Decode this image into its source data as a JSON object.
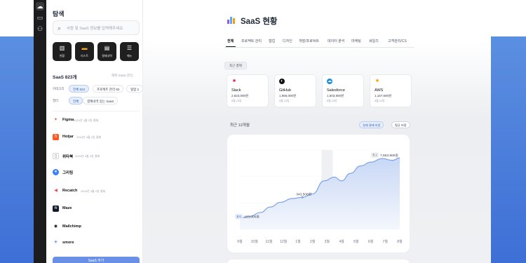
{
  "sidebar": {
    "title": "탐색",
    "search_placeholder": "사람 및 SaaS 정보를 입력해주세요",
    "quick_actions": [
      {
        "label": "현황",
        "icon": "chart-icon"
      },
      {
        "label": "리스트",
        "icon": "folder-icon"
      },
      {
        "label": "결제내역",
        "icon": "receipt-icon"
      },
      {
        "label": "메뉴",
        "icon": "menu-icon"
      }
    ],
    "count_label": "SaaS 823개",
    "count_right": "해외 SaaS 관리",
    "filters": {
      "category_label": "카테고리",
      "category_chips": [
        "전체 823",
        "프로젝트 관리 82",
        "협업 2"
      ],
      "status_label": "필터",
      "status_chips": [
        "전체",
        "결제내역 있는 SaaS"
      ]
    },
    "apps": [
      {
        "name": "Figma",
        "date": "2024년 4월 2일 결제",
        "icon_color": "#f24e1e",
        "glyph": "F"
      },
      {
        "name": "Hotjar",
        "date": "2024년 4월 2일 결제",
        "icon_color": "#ff3c00",
        "glyph": "h"
      },
      {
        "name": "위타북",
        "date": "2024년 4월 2일 결제",
        "icon_color": "#ffffff",
        "glyph": "📄"
      },
      {
        "name": "그리팅",
        "date": "",
        "icon_color": "#3b82f6",
        "glyph": "●"
      },
      {
        "name": "Recatch",
        "date": "2024년 4월 2일 결제",
        "icon_color": "#ef4444",
        "glyph": "▶"
      },
      {
        "name": "Maze",
        "date": "",
        "icon_color": "#111827",
        "glyph": "≋"
      },
      {
        "name": "Mailchimp",
        "date": "",
        "icon_color": "#111111",
        "glyph": "◉"
      },
      {
        "name": "smore",
        "date": "",
        "icon_color": "#3b5bdb",
        "glyph": "✳"
      }
    ],
    "cta_label": "SaaS 추가"
  },
  "main": {
    "title": "SaaS 현황",
    "tabs": [
      "전체",
      "프로젝트 관리",
      "협업",
      "디자인",
      "개발/프로덕트",
      "데이터 분석",
      "마케팅",
      "세일즈",
      "고객관리/CS"
    ],
    "recent_label": "최근 결제",
    "cards": [
      {
        "name": "Slack",
        "amount": "2,823,000원",
        "sub": "8월 23일",
        "icon": "slack-icon",
        "color": "#e01e5a"
      },
      {
        "name": "GitHub",
        "amount": "1,965,000원",
        "sub": "8월 23일",
        "icon": "github-icon",
        "color": "#111111"
      },
      {
        "name": "Salesforce",
        "amount": "1,603,900원",
        "sub": "8월 23일",
        "icon": "salesforce-icon",
        "color": "#1d8ee0"
      },
      {
        "name": "AWS",
        "amount": "1,157,600원",
        "sub": "8월 23일",
        "icon": "aws-icon",
        "color": "#ff9900"
      }
    ],
    "chart_title": "최근 12개월",
    "toggle_on": "실제 결제 비용",
    "toggle_off": "평균 비용"
  },
  "chart_data": {
    "type": "area",
    "x": [
      "9월",
      "10월",
      "11월",
      "12월",
      "1월",
      "2월",
      "3월",
      "4월",
      "5월",
      "6월",
      "7월",
      "8월"
    ],
    "values": [
      123000,
      140000,
      180000,
      240000,
      290000,
      330000,
      343500,
      380000,
      520000,
      560000,
      520000,
      600000,
      680000,
      720000,
      760000,
      740000,
      766390
    ],
    "x_values": [
      0,
      0.7,
      1.4,
      2.1,
      2.8,
      3.6,
      4.3,
      5.0,
      5.8,
      6.5,
      7.0,
      7.6,
      8.3,
      9.0,
      9.8,
      10.5,
      11.0
    ],
    "annotations": [
      {
        "label": "최저",
        "value": "123,000원"
      },
      {
        "label": "",
        "value": "343,500원"
      },
      {
        "label": "최고",
        "value": "7,663,900원"
      }
    ],
    "highlight_month": "3월",
    "ylim": [
      0,
      850000
    ],
    "colors": {
      "line": "#7ea3e9",
      "fill_top": "#c8d8f5",
      "fill_bottom": "#f4f7fd"
    }
  }
}
